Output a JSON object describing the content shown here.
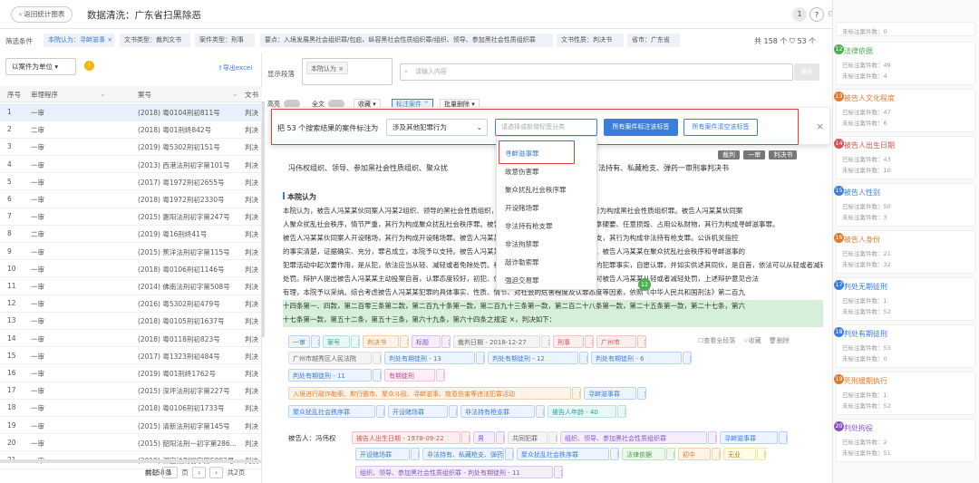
{
  "header": {
    "back_label": "返回统计图表",
    "title": "数据清洗：广东省扫黑除恶",
    "notif_count": "1",
    "invite": "邀请",
    "record": "记录",
    "bulletin": "表报",
    "user": "佟畅"
  },
  "filters": {
    "label": "筛选条件",
    "chips": [
      "本院认为：寻衅滋事 ×",
      "文书类型：裁判文书",
      "案件类型：刑事",
      "要点：入境发展黑社会组织罪/包庇、纵容黑社会性质组织罪/组织、领导、参加黑社会性质组织罪",
      "文书性质：判决书",
      "省市：广东省"
    ],
    "count": "共 158 个",
    "count2": "53 个"
  },
  "left": {
    "unit_select": "以案件为单位",
    "export": "导出excel",
    "columns": [
      "序号",
      "审理程序",
      "案号",
      "文书"
    ],
    "rows": [
      {
        "n": "1",
        "p": "一审",
        "case": "(2018) 粤0104刑初811号",
        "d": "判决"
      },
      {
        "n": "2",
        "p": "二审",
        "case": "(2018) 粤01刑终842号",
        "d": "判决"
      },
      {
        "n": "3",
        "p": "一审",
        "case": "(2019) 粤5302刑初151号",
        "d": "判决"
      },
      {
        "n": "4",
        "p": "一审",
        "case": "(2013) 西港法刑初字第101号",
        "d": "判决"
      },
      {
        "n": "5",
        "p": "一审",
        "case": "(2017) 粤1972刑初2655号",
        "d": "判决"
      },
      {
        "n": "6",
        "p": "一审",
        "case": "(2018) 粤1972刑初2330号",
        "d": "判决"
      },
      {
        "n": "7",
        "p": "一审",
        "case": "(2015) 惠阳法刑初字第247号",
        "d": "判决"
      },
      {
        "n": "8",
        "p": "二审",
        "case": "(2019) 粤16刑终41号",
        "d": "判决"
      },
      {
        "n": "9",
        "p": "一审",
        "case": "(2015) 蕉洋法刑初字第115号",
        "d": "判决"
      },
      {
        "n": "10",
        "p": "一审",
        "case": "(2018) 粤0106刑初1146号",
        "d": "判决"
      },
      {
        "n": "11",
        "p": "一审",
        "case": "(2014) 佛南法刑初字第508号",
        "d": "判决"
      },
      {
        "n": "12",
        "p": "一审",
        "case": "(2016) 粤5302刑初479号",
        "d": "判决"
      },
      {
        "n": "13",
        "p": "一审",
        "case": "(2018) 粤0105刑初1637号",
        "d": "判决"
      },
      {
        "n": "14",
        "p": "一审",
        "case": "(2018) 粤0118刑初823号",
        "d": "判决"
      },
      {
        "n": "15",
        "p": "一审",
        "case": "(2017) 粤1323刑初484号",
        "d": "判决"
      },
      {
        "n": "16",
        "p": "一审",
        "case": "(2019) 粤01刑终1762号",
        "d": "判决"
      },
      {
        "n": "17",
        "p": "一审",
        "case": "(2015) 深坪法刑初字第227号",
        "d": "判决"
      },
      {
        "n": "18",
        "p": "一审",
        "case": "(2018) 粤0106刑初1733号",
        "d": "判决"
      },
      {
        "n": "19",
        "p": "一审",
        "case": "(2015) 清新法刑初字第145号",
        "d": "判决"
      },
      {
        "n": "20",
        "p": "一审",
        "case": "(2015) 韶阳法刑一初字第286...",
        "d": "判决"
      },
      {
        "n": "21",
        "p": "一审",
        "case": "(2019) 深宝法刑初字第5092号",
        "d": "判决"
      }
    ],
    "total": "共158条",
    "page_prefix": "前往",
    "page": "1",
    "page_suffix": "页",
    "pages": "共2页"
  },
  "mid": {
    "display_label": "显示段落",
    "para_select": "本院认为 ×",
    "search_placeholder": "请输入内容",
    "search_btn": "搜索",
    "toggles": [
      "高亮",
      "全文"
    ],
    "menus": [
      "收藏",
      "标注案件",
      "批量删除"
    ],
    "tabs": [
      "裁判",
      "一审",
      "判决书"
    ],
    "case_title": "冯伟权组织、领导、参加黑社会性质组织、聚众扰乱社会秩序、寻衅滋事、开设赌场、非法持有、私藏枪支、弹药一审刑事判决书",
    "section": "本院认为",
    "para": [
      "本院认为，被告人冯某某伙同案人冯某2组织、领导的黑社会性质组织，有组织地实施违法犯罪活动，其行为构成黑社会性质组织罪。被告人冯某某伙同案",
      "人聚众扰乱社会秩序，情节严重，其行为构成聚众扰乱社会秩序罪。被告人冯某某多次随意殴打他人，强拿硬要、任意损毁、占用公私财物，其行为构成寻衅滋事罪。",
      "被告人冯某某伙同案人开设赌场，其行为构成开设赌场罪。被告人冯某某违反枪支管理规定，非法持有枪支，其行为构成非法持有枪支罪。公诉机关指控",
      "的事实清楚，证据确实、充分，罪名成立，本院予以支持。被告人冯某某一人犯数罪，依法应当数罪并罚。被告人冯某某在聚众扰乱社会秩序和寻衅滋事的",
      "犯罪活动中起次要作用，是从犯，依法应当从轻、减轻或者免除处罚。被告人冯某某归案后如实供述自己的犯罪事实，自愿认罪，并如实供述其同伙，是自首，依法可以从轻或者减轻",
      "处罚。辩护人提出被告人冯某某主动投案自首，认罪态度较好，初犯、偶犯等辩护意见，经查属实，请求对被告人冯某某从轻或者减轻处罚，上述辩护意见合法",
      "有理，本院予以采纳。综合考虑被告人冯某某犯罪的具体事实、性质、情节、对社会的危害程度及认罪态度等因素，依照《中华人民共和国刑法》第二百九",
      "十四条第一、四款，第二百零三条第二款，第二百九十条第一款，第二百九十三条第一款，第二百二十八条第一款，第二十五条第一款，第二十七条，第六",
      "十七条第一款，第五十二条，第五十三条，第六十九条，第六十四条之规定 ×，判决如下："
    ],
    "dialog": {
      "prefix": "把 53 个搜索结果的案件标注为",
      "select": "涉及其他犯罪行为",
      "input_placeholder": "请选择或新增标签分类",
      "btn1": "所有案件标注该标签",
      "btn2": "所有案件清空该标签"
    },
    "dropdown": [
      "寻衅滋事罪",
      "故意伤害罪",
      "聚众扰乱社会秩序罪",
      "开设赌场罪",
      "非法持有枪支罪",
      "非法拘禁罪",
      "敲诈勒索罪",
      "强迫交易罪"
    ],
    "annot_count": "12",
    "actions": [
      "查看全段落",
      "收藏",
      "删除"
    ],
    "tags1": [
      "一审",
      "案号",
      "判决书",
      "标题",
      "裁判日期 - 2018-12-27",
      "刑事",
      "广州市"
    ],
    "tags2": [
      "广州市越秀区人民法院",
      "判处有期徒刑 - 13",
      "判处有期徒刑 - 12",
      "判处有期徒刑 - 6"
    ],
    "tags3": [
      "判处有期徒刑 - 11",
      "有期徒刑"
    ],
    "tags4": [
      "入境进行敲诈勒索、欺行霸市、聚众斗殴、寻衅滋事、故意伤害等违法犯罪活动",
      "寻衅滋事罪"
    ],
    "tags5": [
      "聚众扰乱社会秩序罪",
      "开设赌场罪",
      "非法持有枪支罪",
      "被告人年龄 - 40"
    ],
    "defendant": "被告人：冯伟权",
    "tags6": [
      "被告人出生日期 - 1978-09-22",
      "男",
      "共同犯罪",
      "组织、领导、参加黑社会性质组织罪",
      "寻衅滋事罪"
    ],
    "tags7": [
      "开设赌场罪",
      "非法持有、私藏枪支、弹药罪",
      "聚众扰乱社会秩序罪",
      "法律依据",
      "初中",
      "无业"
    ],
    "tags8": [
      "组织、领导、参加黑社会性质组织罪 - 判处有期徒刑 - 11"
    ]
  },
  "right": {
    "cards": [
      {
        "n": "",
        "title": "",
        "l1": "未标注案件数：0",
        "l2": ""
      },
      {
        "n": "12",
        "title": "法律依据",
        "l1": "已标注案件数：49",
        "l2": "未标注案件数：4",
        "color": "#4caf50"
      },
      {
        "n": "13",
        "title": "被告人文化程度",
        "l1": "已标注案件数：47",
        "l2": "未标注案件数：6",
        "color": "#e07b2c"
      },
      {
        "n": "14",
        "title": "被告人出生日期",
        "l1": "已标注案件数：43",
        "l2": "未标注案件数：10",
        "color": "#d35454"
      },
      {
        "n": "15",
        "title": "被告人性别",
        "l1": "已标注案件数：50",
        "l2": "未标注案件数：3",
        "color": "#3b7ddd"
      },
      {
        "n": "16",
        "title": "被告人身份",
        "l1": "已标注案件数：21",
        "l2": "未标注案件数：32",
        "color": "#e07b2c"
      },
      {
        "n": "17",
        "title": "判处无期徒刑",
        "l1": "已标注案件数：1",
        "l2": "未标注案件数：52",
        "color": "#3b7ddd"
      },
      {
        "n": "18",
        "title": "判处有期徒刑",
        "l1": "已标注案件数：53",
        "l2": "未标注案件数：0",
        "color": "#3b7ddd"
      },
      {
        "n": "19",
        "title": "死刑缓期执行",
        "l1": "已标注案件数：1",
        "l2": "未标注案件数：52",
        "color": "#e07b2c"
      },
      {
        "n": "20",
        "title": "判处拘役",
        "l1": "已标注案件数：2",
        "l2": "未标注案件数：51",
        "color": "#8855c4"
      }
    ]
  }
}
